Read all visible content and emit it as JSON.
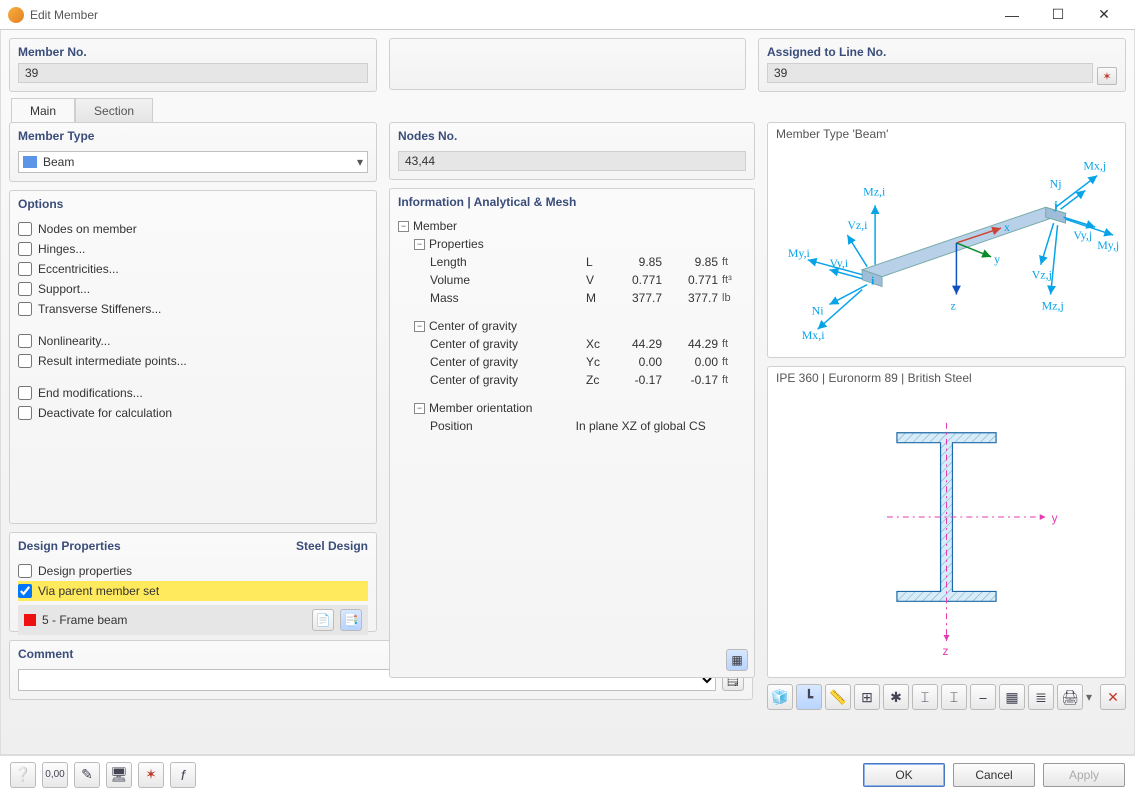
{
  "window": {
    "title": "Edit Member"
  },
  "member_no": {
    "label": "Member No.",
    "value": "39"
  },
  "assigned": {
    "label": "Assigned to Line No.",
    "value": "39"
  },
  "tabs": {
    "main": "Main",
    "section": "Section"
  },
  "member_type": {
    "label": "Member Type",
    "value": "Beam"
  },
  "options": {
    "label": "Options",
    "items": [
      "Nodes on member",
      "Hinges...",
      "Eccentricities...",
      "Support...",
      "Transverse Stiffeners...",
      "Nonlinearity...",
      "Result intermediate points...",
      "End modifications...",
      "Deactivate for calculation"
    ]
  },
  "design": {
    "label": "Design Properties",
    "right": "Steel Design",
    "chk1": "Design properties",
    "chk2": "Via parent member set",
    "item": "5 - Frame beam"
  },
  "comment": {
    "label": "Comment"
  },
  "nodes": {
    "label": "Nodes No.",
    "value": "43,44"
  },
  "info": {
    "label": "Information | Analytical & Mesh",
    "member": "Member",
    "properties": "Properties",
    "length": {
      "name": "Length",
      "sym": "L",
      "v1": "9.85",
      "v2": "9.85",
      "u": "ft"
    },
    "volume": {
      "name": "Volume",
      "sym": "V",
      "v1": "0.771",
      "v2": "0.771",
      "u": "ft³"
    },
    "mass": {
      "name": "Mass",
      "sym": "M",
      "v1": "377.7",
      "v2": "377.7",
      "u": "lb"
    },
    "cog": "Center of gravity",
    "xc": {
      "name": "Center of gravity",
      "sym": "Xc",
      "v1": "44.29",
      "v2": "44.29",
      "u": "ft"
    },
    "yc": {
      "name": "Center of gravity",
      "sym": "Yc",
      "v1": "0.00",
      "v2": "0.00",
      "u": "ft"
    },
    "zc": {
      "name": "Center of gravity",
      "sym": "Zc",
      "v1": "-0.17",
      "v2": "-0.17",
      "u": "ft"
    },
    "orient": "Member orientation",
    "position": "Position",
    "position_val": "In plane XZ of global CS"
  },
  "preview1": {
    "label": "Member Type 'Beam'",
    "labels": {
      "mxj": "Mx,j",
      "nj": "Nj",
      "mzi": "Mz,i",
      "vzi": "Vz,i",
      "vyj": "Vy,j",
      "myj": "My,j",
      "myi": "My,i",
      "vyi": "Vy,i",
      "vzj": "Vz,j",
      "mzj": "Mz,j",
      "ni": "Ni",
      "mxi": "Mx,i",
      "x": "x",
      "y": "y",
      "z": "z",
      "i": "i",
      "j": "j"
    }
  },
  "preview2": {
    "label": "IPE 360 | Euronorm 89 | British Steel",
    "y": "y",
    "z": "z"
  },
  "footer": {
    "ok": "OK",
    "cancel": "Cancel",
    "apply": "Apply"
  }
}
